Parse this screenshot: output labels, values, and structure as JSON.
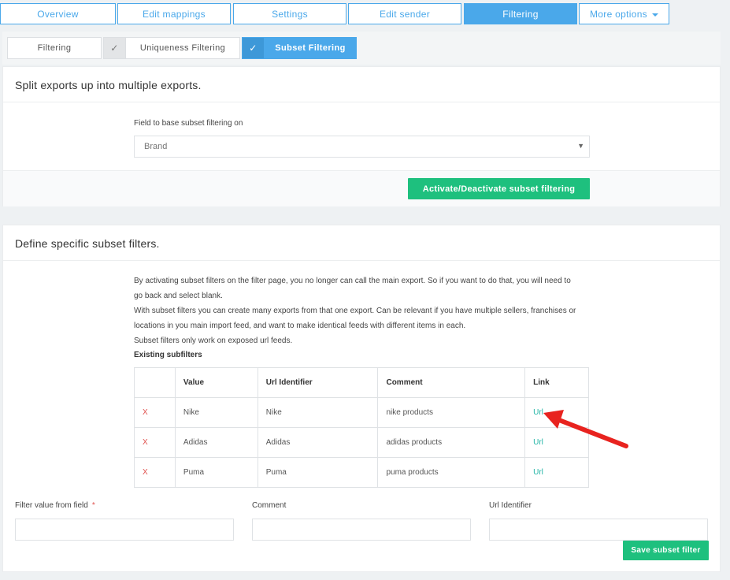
{
  "top_tabs": [
    {
      "label": "Overview"
    },
    {
      "label": "Edit mappings"
    },
    {
      "label": "Settings"
    },
    {
      "label": "Edit sender"
    },
    {
      "label": "Filtering"
    },
    {
      "label": "More options"
    }
  ],
  "sub_tabs": [
    {
      "label": "Filtering"
    },
    {
      "label": "Uniqueness Filtering",
      "check": "✓"
    },
    {
      "label": "Subset Filtering",
      "check": "✓"
    }
  ],
  "split_panel": {
    "title": "Split exports up into multiple exports.",
    "field_label": "Field to base subset filtering on",
    "selected_value": "Brand",
    "activate_button": "Activate/Deactivate subset filtering"
  },
  "define_panel": {
    "title": "Define specific subset filters.",
    "info_lines": [
      "By activating subset filters on the filter page, you no longer can call the main export. So if you want to do that, you will need to",
      "go back and select blank.",
      "With subset filters you can create many exports from that one export. Can be relevant if you have multiple sellers, franchises or",
      "locations in you main import feed, and want to make identical feeds with different items in each.",
      "Subset filters only work on exposed url feeds."
    ],
    "existing_label": "Existing subfilters",
    "columns": [
      "",
      "Value",
      "Url Identifier",
      "Comment",
      "Link"
    ],
    "rows": [
      {
        "delete": "X",
        "value": "Nike",
        "url_identifier": "Nike",
        "comment": "nike products",
        "link": "Url"
      },
      {
        "delete": "X",
        "value": "Adidas",
        "url_identifier": "Adidas",
        "comment": "adidas products",
        "link": "Url"
      },
      {
        "delete": "X",
        "value": "Puma",
        "url_identifier": "Puma",
        "comment": "puma products",
        "link": "Url"
      }
    ],
    "form": {
      "filter_value_label": "Filter value from field",
      "required_mark": "*",
      "comment_label": "Comment",
      "url_identifier_label": "Url Identifier",
      "filter_value": "",
      "comment_value": "",
      "url_identifier_value": "",
      "save_button": "Save subset filter"
    }
  },
  "colors": {
    "accent_blue": "#4aa8ea",
    "green": "#1ec07e",
    "delete_red": "#e0524f",
    "link_teal": "#23b5a6",
    "annotation_arrow": "#e8231f"
  }
}
